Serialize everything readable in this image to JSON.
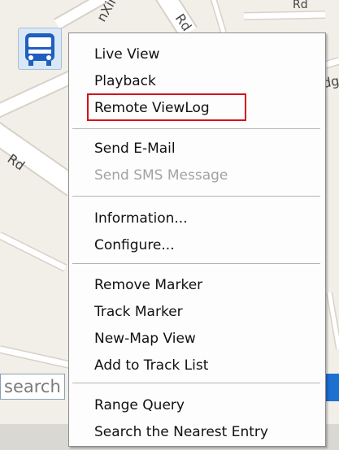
{
  "map": {
    "road_labels": [
      "Rd",
      "Rd",
      "dg",
      "nXin",
      "Rd"
    ],
    "search_placeholder": "search"
  },
  "context_menu": {
    "groups": [
      [
        "Live View",
        "Playback",
        "Remote ViewLog"
      ],
      [
        "Send E-Mail",
        "Send SMS Message"
      ],
      [
        "Information...",
        "Configure..."
      ],
      [
        "Remove Marker",
        "Track Marker",
        "New-Map View",
        "Add to Track List"
      ],
      [
        "Range Query",
        "Search the Nearest Entry"
      ]
    ],
    "disabled_items": [
      "Send SMS Message"
    ],
    "highlighted_item": "Remote ViewLog",
    "highlight_color": "#d3121a"
  },
  "colors": {
    "map_background": "#f2efe9",
    "road": "#ffffff",
    "menu_background": "#fdfdfd",
    "disabled_text": "#a3a3a3",
    "marker_background": "#d8e8f6",
    "bus_icon": "#1f5fbf",
    "accent_blue": "#1d6fd0"
  },
  "icons": {
    "marker": "bus-icon"
  }
}
